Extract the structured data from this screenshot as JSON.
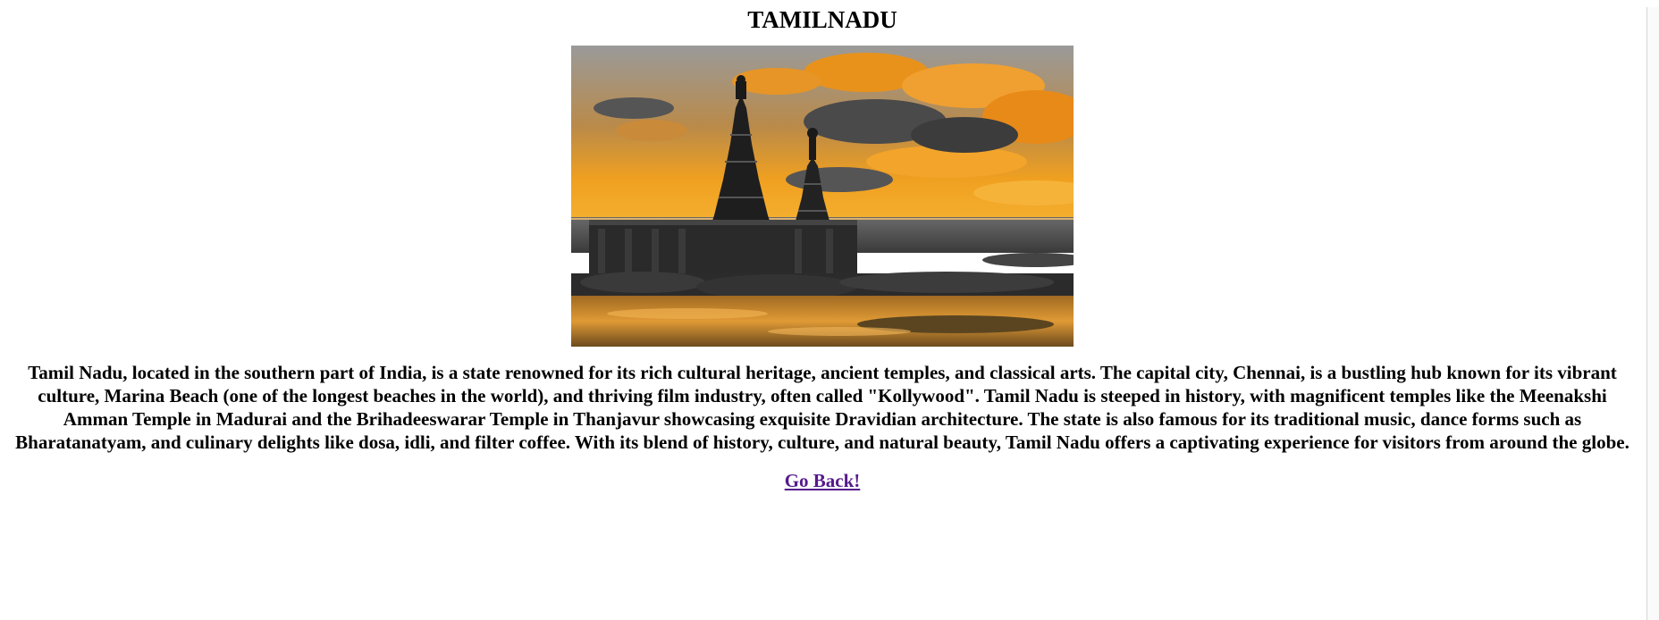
{
  "page": {
    "title": "TAMILNADU",
    "image": {
      "icon": "shore-temple-sunset-photo",
      "colors": {
        "sky_orange": "#e8921c",
        "sky_grey": "#8a8a8a",
        "cloud_dark": "#3c3c3c",
        "stone": "#1e1e1e",
        "water": "#c98a2c"
      }
    },
    "description": "Tamil Nadu, located in the southern part of India, is a state renowned for its rich cultural heritage, ancient temples, and classical arts. The capital city, Chennai, is a bustling hub known for its vibrant culture, Marina Beach (one of the longest beaches in the world), and thriving film industry, often called \"Kollywood\". Tamil Nadu is steeped in history, with magnificent temples like the Meenakshi Amman Temple in Madurai and the Brihadeeswarar Temple in Thanjavur showcasing exquisite Dravidian architecture. The state is also famous for its traditional music, dance forms such as Bharatanatyam, and culinary delights like dosa, idli, and filter coffee. With its blend of history, culture, and natural beauty, Tamil Nadu offers a captivating experience for visitors from around the globe.",
    "back_link": "Go Back!",
    "link_color": "#551a8b"
  }
}
